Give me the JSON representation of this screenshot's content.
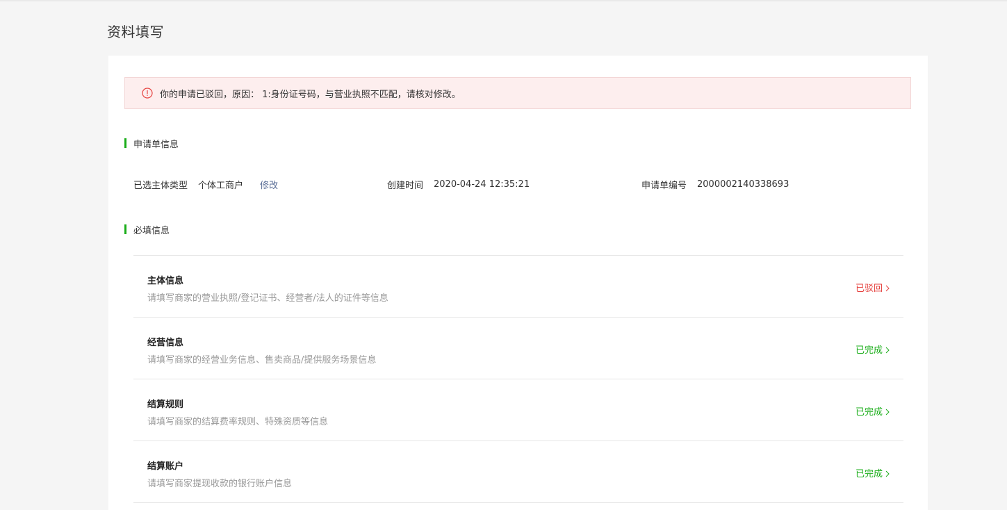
{
  "page": {
    "title": "资料填写"
  },
  "alert": {
    "icon": "exclamation-circle-icon",
    "text": "你的申请已驳回，原因： 1:身份证号码，与营业执照不匹配，请核对修改。",
    "color": "#e64340"
  },
  "application_section": {
    "title": "申请单信息",
    "subject_type_label": "已选主体类型",
    "subject_type_value": "个体工商户",
    "modify_link": "修改",
    "created_time_label": "创建时间",
    "created_time_value": "2020-04-24 12:35:21",
    "application_no_label": "申请单编号",
    "application_no_value": "2000002140338693"
  },
  "required_section": {
    "title": "必填信息",
    "items": [
      {
        "title": "主体信息",
        "desc": "请填写商家的营业执照/登记证书、经营者/法人的证件等信息",
        "status": "已驳回",
        "status_color": "#e64340"
      },
      {
        "title": "经营信息",
        "desc": "请填写商家的经营业务信息、售卖商品/提供服务场景信息",
        "status": "已完成",
        "status_color": "#1aad19"
      },
      {
        "title": "结算规则",
        "desc": "请填写商家的结算费率规则、特殊资质等信息",
        "status": "已完成",
        "status_color": "#1aad19"
      },
      {
        "title": "结算账户",
        "desc": "请填写商家提现收款的银行账户信息",
        "status": "已完成",
        "status_color": "#1aad19"
      }
    ]
  },
  "colors": {
    "accent_green": "#1aad19",
    "link_blue": "#576b95",
    "reject_red": "#e64340"
  }
}
